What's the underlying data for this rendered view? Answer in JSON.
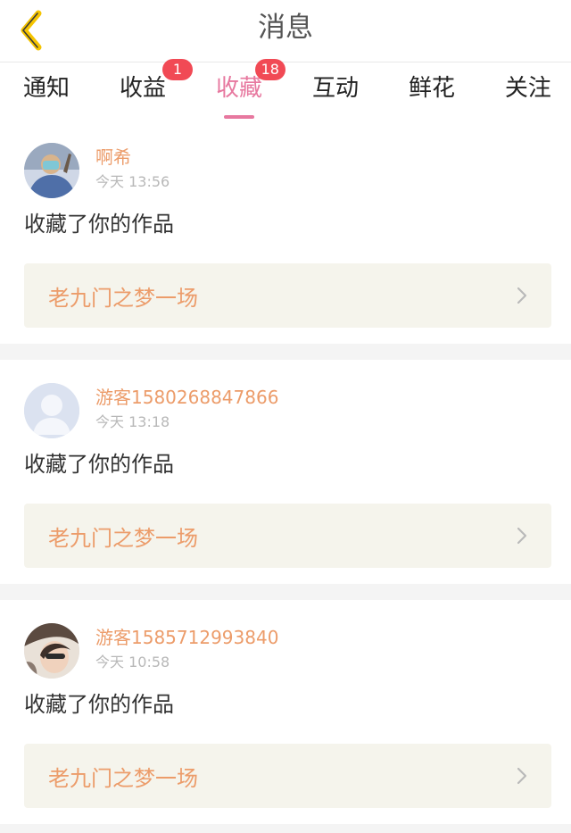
{
  "header": {
    "title": "消息"
  },
  "tabs": [
    {
      "label": "通知",
      "badge": ""
    },
    {
      "label": "收益",
      "badge": "1"
    },
    {
      "label": "收藏",
      "badge": "18"
    },
    {
      "label": "互动",
      "badge": ""
    },
    {
      "label": "鲜花",
      "badge": ""
    },
    {
      "label": "关注",
      "badge": ""
    }
  ],
  "active_tab": "收藏",
  "messages": [
    {
      "username": "啊希",
      "time": "今天 13:56",
      "action": "收藏了你的作品",
      "work_title": "老九门之梦一场",
      "avatar": "photo-avatar-icon"
    },
    {
      "username": "游客1580268847866",
      "time": "今天 13:18",
      "action": "收藏了你的作品",
      "work_title": "老九门之梦一场",
      "avatar": "default-avatar-icon"
    },
    {
      "username": "游客1585712993840",
      "time": "今天 10:58",
      "action": "收藏了你的作品",
      "work_title": "老九门之梦一场",
      "avatar": "photo-avatar-icon"
    }
  ],
  "colors": {
    "accent": "#e7789f",
    "badge": "#f14a55",
    "name": "#ec9c6a",
    "back_icon": "#f5c400"
  }
}
